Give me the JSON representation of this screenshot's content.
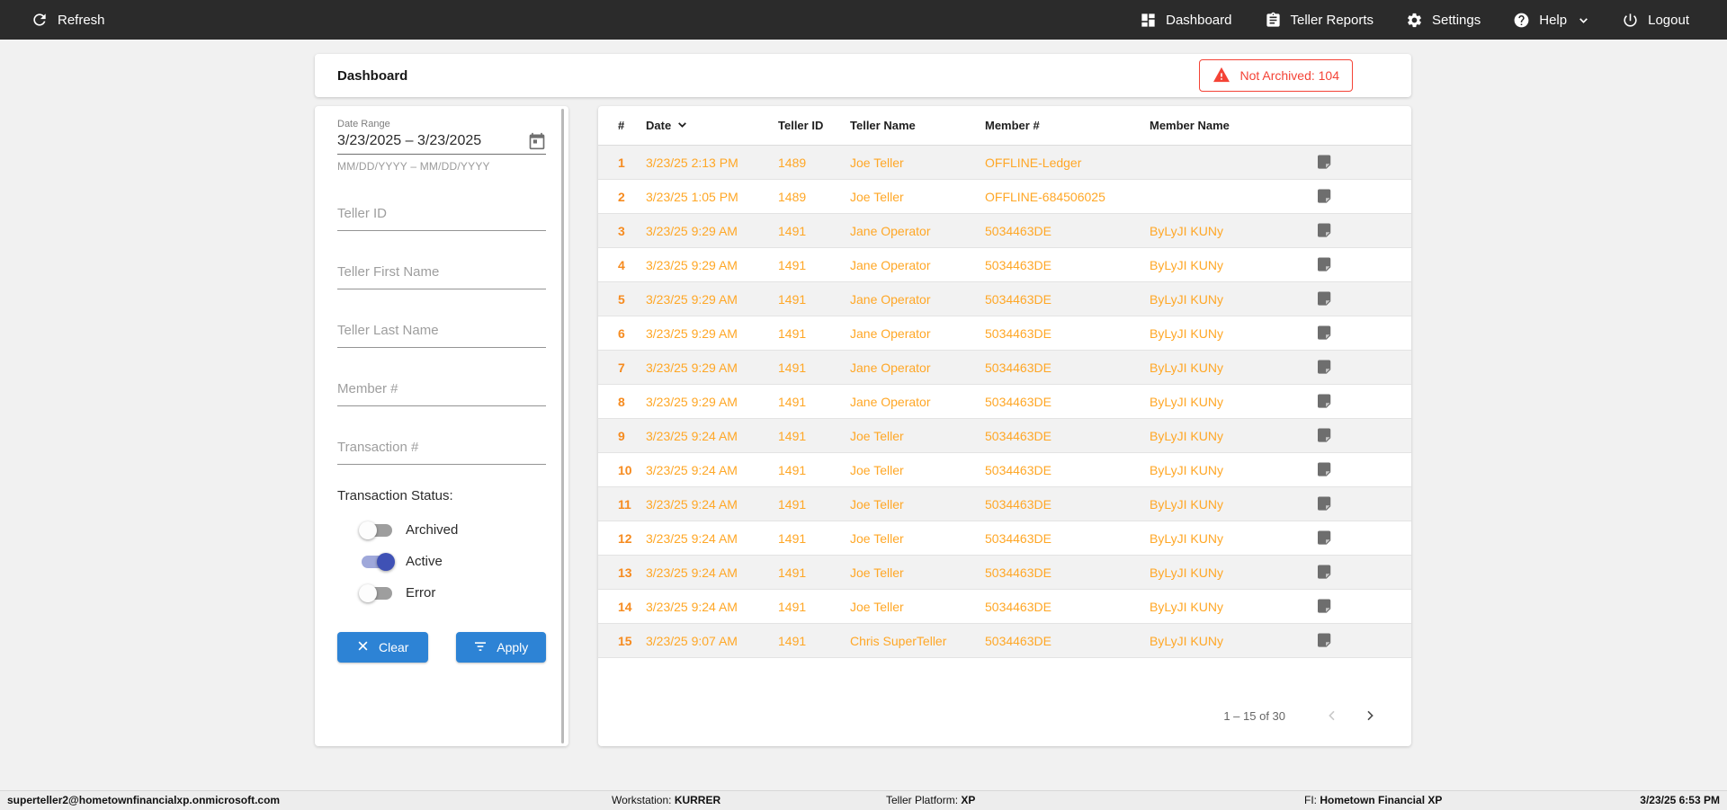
{
  "topnav": {
    "refresh_label": "Refresh",
    "items": [
      {
        "label": "Dashboard",
        "icon": "dashboard-icon"
      },
      {
        "label": "Teller Reports",
        "icon": "clipboard-icon"
      },
      {
        "label": "Settings",
        "icon": "gear-icon"
      },
      {
        "label": "Help",
        "icon": "help-icon"
      },
      {
        "label": "Logout",
        "icon": "power-icon"
      }
    ]
  },
  "header": {
    "title": "Dashboard",
    "not_archived_label": "Not Archived: 104"
  },
  "filters": {
    "date_range": {
      "label": "Date Range",
      "value": "3/23/2025 – 3/23/2025",
      "helper": "MM/DD/YYYY – MM/DD/YYYY"
    },
    "fields": [
      {
        "placeholder": "Teller ID"
      },
      {
        "placeholder": "Teller First Name"
      },
      {
        "placeholder": "Teller Last Name"
      },
      {
        "placeholder": "Member #"
      },
      {
        "placeholder": "Transaction #"
      }
    ],
    "status": {
      "label": "Transaction Status:",
      "toggles": [
        {
          "label": "Archived",
          "on": false
        },
        {
          "label": "Active",
          "on": true
        },
        {
          "label": "Error",
          "on": false
        }
      ]
    },
    "clear_label": "Clear",
    "apply_label": "Apply"
  },
  "table": {
    "columns": [
      "#",
      "Date",
      "Teller ID",
      "Teller Name",
      "Member #",
      "Member Name"
    ],
    "sorted_column": "Date",
    "rows": [
      {
        "num": "1",
        "date": "3/23/25 2:13 PM",
        "teller_id": "1489",
        "teller_name": "Joe Teller",
        "member_num": "OFFLINE-Ledger",
        "member_name": ""
      },
      {
        "num": "2",
        "date": "3/23/25 1:05 PM",
        "teller_id": "1489",
        "teller_name": "Joe Teller",
        "member_num": "OFFLINE-684506025",
        "member_name": ""
      },
      {
        "num": "3",
        "date": "3/23/25 9:29 AM",
        "teller_id": "1491",
        "teller_name": "Jane Operator",
        "member_num": "5034463DE",
        "member_name": "ByLyJI KUNy"
      },
      {
        "num": "4",
        "date": "3/23/25 9:29 AM",
        "teller_id": "1491",
        "teller_name": "Jane Operator",
        "member_num": "5034463DE",
        "member_name": "ByLyJI KUNy"
      },
      {
        "num": "5",
        "date": "3/23/25 9:29 AM",
        "teller_id": "1491",
        "teller_name": "Jane Operator",
        "member_num": "5034463DE",
        "member_name": "ByLyJI KUNy"
      },
      {
        "num": "6",
        "date": "3/23/25 9:29 AM",
        "teller_id": "1491",
        "teller_name": "Jane Operator",
        "member_num": "5034463DE",
        "member_name": "ByLyJI KUNy"
      },
      {
        "num": "7",
        "date": "3/23/25 9:29 AM",
        "teller_id": "1491",
        "teller_name": "Jane Operator",
        "member_num": "5034463DE",
        "member_name": "ByLyJI KUNy"
      },
      {
        "num": "8",
        "date": "3/23/25 9:29 AM",
        "teller_id": "1491",
        "teller_name": "Jane Operator",
        "member_num": "5034463DE",
        "member_name": "ByLyJI KUNy"
      },
      {
        "num": "9",
        "date": "3/23/25 9:24 AM",
        "teller_id": "1491",
        "teller_name": "Joe Teller",
        "member_num": "5034463DE",
        "member_name": "ByLyJI KUNy"
      },
      {
        "num": "10",
        "date": "3/23/25 9:24 AM",
        "teller_id": "1491",
        "teller_name": "Joe Teller",
        "member_num": "5034463DE",
        "member_name": "ByLyJI KUNy"
      },
      {
        "num": "11",
        "date": "3/23/25 9:24 AM",
        "teller_id": "1491",
        "teller_name": "Joe Teller",
        "member_num": "5034463DE",
        "member_name": "ByLyJI KUNy"
      },
      {
        "num": "12",
        "date": "3/23/25 9:24 AM",
        "teller_id": "1491",
        "teller_name": "Joe Teller",
        "member_num": "5034463DE",
        "member_name": "ByLyJI KUNy"
      },
      {
        "num": "13",
        "date": "3/23/25 9:24 AM",
        "teller_id": "1491",
        "teller_name": "Joe Teller",
        "member_num": "5034463DE",
        "member_name": "ByLyJI KUNy"
      },
      {
        "num": "14",
        "date": "3/23/25 9:24 AM",
        "teller_id": "1491",
        "teller_name": "Joe Teller",
        "member_num": "5034463DE",
        "member_name": "ByLyJI KUNy"
      },
      {
        "num": "15",
        "date": "3/23/25 9:07 AM",
        "teller_id": "1491",
        "teller_name": "Chris SuperTeller",
        "member_num": "5034463DE",
        "member_name": "ByLyJI KUNy"
      }
    ],
    "pagination": {
      "range": "1 – 15 of 30"
    }
  },
  "statusbar": {
    "user": "superteller2@hometownfinancialxp.onmicrosoft.com",
    "workstation_label": "Workstation:",
    "workstation": "KURRER",
    "platform_label": "Teller Platform:",
    "platform": "XP",
    "fi_label": "FI:",
    "fi": "Hometown Financial XP",
    "timestamp": "3/23/25 6:53 PM"
  },
  "colors": {
    "nav_bg": "#2b2b2b",
    "accent_blue": "#2d83d5",
    "row_orange": "#ffa726",
    "row_number_orange": "#f68b1f",
    "alert_red": "#f44336",
    "toggle_on_indigo": "#3f51b5"
  }
}
